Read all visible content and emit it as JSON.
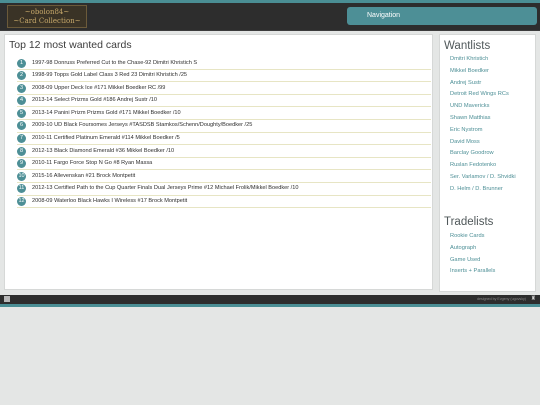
{
  "brand": {
    "line1": "~obolon84~",
    "line2": "~Card Collection~"
  },
  "navigation": {
    "label": "Navigation"
  },
  "main": {
    "title": "Top 12 most wanted cards",
    "cards": [
      {
        "num": "1",
        "text": "1997-98 Donruss Preferred Cut to the Chase-92 Dimitri Khristich S"
      },
      {
        "num": "2",
        "text": "1998-99 Topps Gold Label Class 3 Red 23 Dimitri Khristich /25"
      },
      {
        "num": "3",
        "text": "2008-09 Upper Deck Ice #171 Mikkel Boedker RC /99"
      },
      {
        "num": "4",
        "text": "2013-14 Select Prizms Gold #186 Andrej Sustr /10"
      },
      {
        "num": "5",
        "text": "2013-14 Panini Prizm Prizms Gold #171 Mikkel Boedker /10"
      },
      {
        "num": "6",
        "text": "2009-10 UD Black Foursomes Jerseys #TASDSB Stamkos/Schenn/Doughty/Boedker /25"
      },
      {
        "num": "7",
        "text": "2010-11 Certified Platinum Emerald #114 Mikkel Boedker /5"
      },
      {
        "num": "8",
        "text": "2012-13 Black Diamond Emerald #36 Mikkel Boedker /10"
      },
      {
        "num": "9",
        "text": "2010-11 Fargo Force Stop N Go #8 Ryan Massa"
      },
      {
        "num": "10",
        "text": "2015-16 Allevenskan #21 Brock Montpetit"
      },
      {
        "num": "11",
        "text": "2012-13 Certified Path to the Cup Quarter Finals Dual Jerseys Prime #12 Michael Frolik/Mikkel Boedker /10"
      },
      {
        "num": "12",
        "text": "2008-09 Waterloo Black Hawks I Wireless #17 Brock Montpetit"
      }
    ]
  },
  "sidebar": {
    "wantlists_title": "Wantlists",
    "wantlists": [
      "Dmitri Khristich",
      "Mikkel Boedker",
      "Andrej Sustr",
      "Detroit Red Wings RCs",
      "UND Mavericks",
      "Shawn Matthias",
      "Eric Nystrom",
      "David Moss",
      "Barclay Goodrow",
      "Ruslan Fedotenko",
      "Ser. Varlamov / D. Shvidki",
      "D. Helm / D. Brunner"
    ],
    "tradelists_title": "Tradelists",
    "tradelists": [
      "Rookie Cards",
      "Autograph",
      "Game Used",
      "Inserts + Parallels"
    ]
  },
  "footer": {
    "credit": "designed by Evgeny (ugovsky)",
    "glyph": "♜"
  }
}
